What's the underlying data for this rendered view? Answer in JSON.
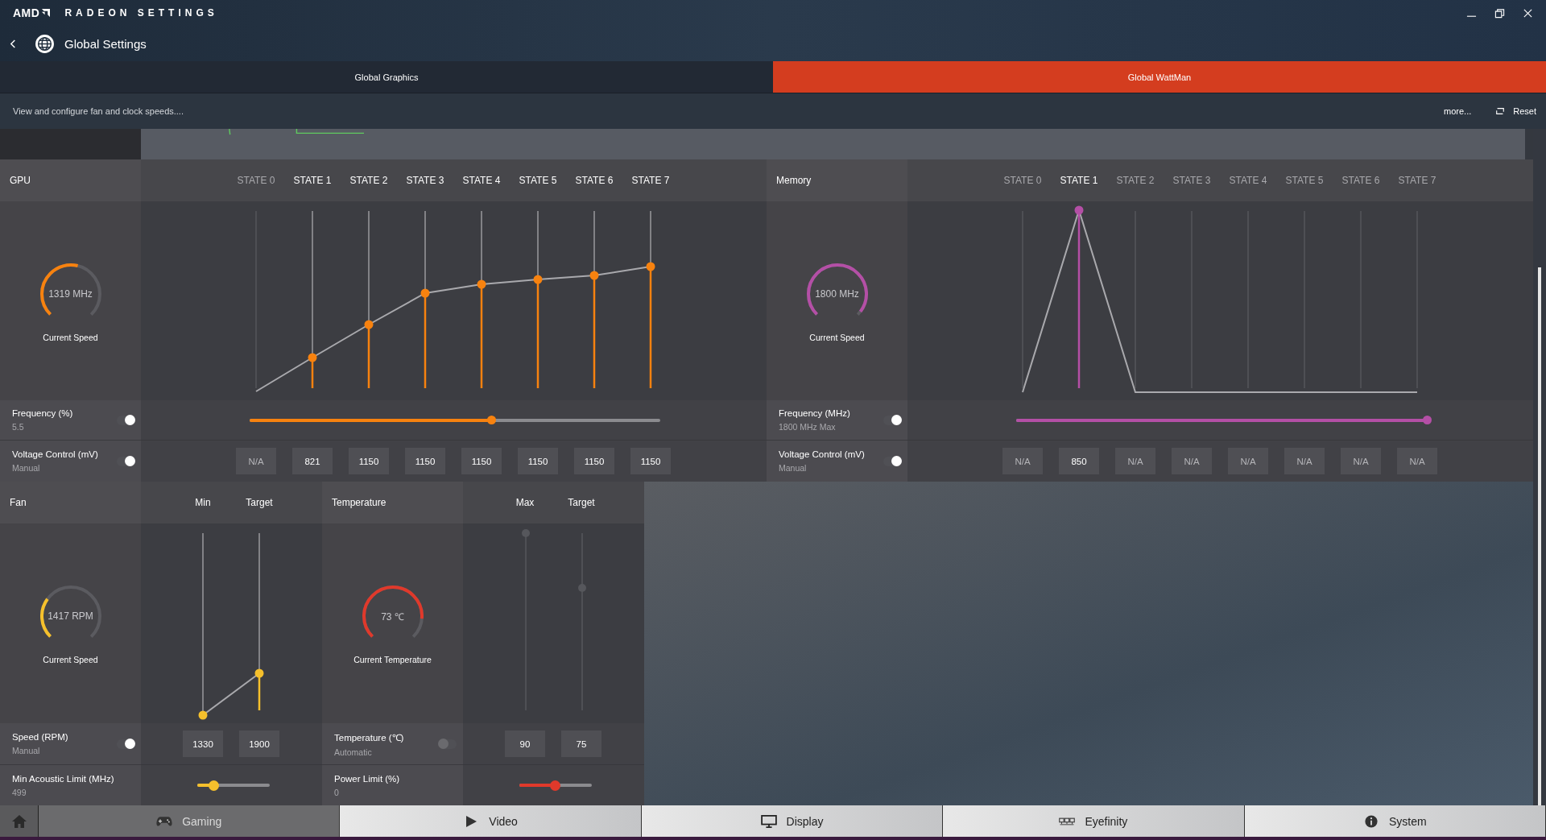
{
  "app": {
    "brand": "AMD",
    "title": "RADEON SETTINGS"
  },
  "header": {
    "title": "Global Settings"
  },
  "tabs": [
    {
      "label": "Global Graphics",
      "selected": false
    },
    {
      "label": "Global WattMan",
      "selected": true
    }
  ],
  "description": "View and configure fan and clock speeds....",
  "actions": {
    "more": "more...",
    "reset": "Reset"
  },
  "clock_panels": [
    {
      "title": "GPU",
      "color": "#f7820f",
      "gauge": {
        "reading": "1319 MHz",
        "caption": "Current Speed",
        "level": 0.55
      },
      "states": [
        {
          "label": "STATE 0",
          "disabled": true
        },
        {
          "label": "STATE 1",
          "disabled": false
        },
        {
          "label": "STATE 2",
          "disabled": false
        },
        {
          "label": "STATE 3",
          "disabled": false
        },
        {
          "label": "STATE 4",
          "disabled": false
        },
        {
          "label": "STATE 5",
          "disabled": false
        },
        {
          "label": "STATE 6",
          "disabled": false
        },
        {
          "label": "STATE 7",
          "disabled": false
        }
      ],
      "frequency": {
        "label": "Frequency (%)",
        "value": "5.5",
        "on": true,
        "level": 0.59
      },
      "voltage": {
        "label": "Voltage Control (mV)",
        "value": "Manual",
        "on": true,
        "cells": [
          {
            "text": "N/A",
            "disabled": true
          },
          {
            "text": "821",
            "disabled": false
          },
          {
            "text": "1150",
            "disabled": false
          },
          {
            "text": "1150",
            "disabled": false
          },
          {
            "text": "1150",
            "disabled": false
          },
          {
            "text": "1150",
            "disabled": false
          },
          {
            "text": "1150",
            "disabled": false
          },
          {
            "text": "1150",
            "disabled": false
          }
        ]
      }
    },
    {
      "title": "Memory",
      "color": "#b44fa6",
      "gauge": {
        "reading": "1800 MHz",
        "caption": "Current Speed",
        "level": 0.97
      },
      "states": [
        {
          "label": "STATE 0",
          "disabled": true
        },
        {
          "label": "STATE 1",
          "disabled": false
        },
        {
          "label": "STATE 2",
          "disabled": true
        },
        {
          "label": "STATE 3",
          "disabled": true
        },
        {
          "label": "STATE 4",
          "disabled": true
        },
        {
          "label": "STATE 5",
          "disabled": true
        },
        {
          "label": "STATE 6",
          "disabled": true
        },
        {
          "label": "STATE 7",
          "disabled": true
        }
      ],
      "frequency": {
        "label": "Frequency (MHz)",
        "value": "1800 MHz Max",
        "on": true,
        "level": 1.0
      },
      "voltage": {
        "label": "Voltage Control (mV)",
        "value": "Manual",
        "on": true,
        "cells": [
          {
            "text": "N/A",
            "disabled": true
          },
          {
            "text": "850",
            "disabled": false
          },
          {
            "text": "N/A",
            "disabled": true
          },
          {
            "text": "N/A",
            "disabled": true
          },
          {
            "text": "N/A",
            "disabled": true
          },
          {
            "text": "N/A",
            "disabled": true
          },
          {
            "text": "N/A",
            "disabled": true
          },
          {
            "text": "N/A",
            "disabled": true
          }
        ]
      }
    }
  ],
  "cooling_panels": [
    {
      "title": "Fan",
      "color": "#f5c02c",
      "gauge": {
        "reading": "1417 RPM",
        "caption": "Current Speed",
        "level": 0.3
      },
      "columns": [
        "Min",
        "Target"
      ],
      "control": {
        "label": "Speed (RPM)",
        "value": "Manual",
        "on": true
      },
      "fields": [
        "1330",
        "1900"
      ],
      "limit": {
        "label": "Min Acoustic Limit (MHz)",
        "value": "499",
        "level": 0.23
      }
    },
    {
      "title": "Temperature",
      "color": "#e0392b",
      "gauge": {
        "reading": "73 ℃",
        "caption": "Current Temperature",
        "level": 0.85
      },
      "columns": [
        "Max",
        "Target"
      ],
      "control": {
        "label": "Temperature (℃)",
        "value": "Automatic",
        "on": false
      },
      "fields": [
        "90",
        "75"
      ],
      "limit": {
        "label": "Power Limit (%)",
        "value": "0",
        "level": 0.49
      }
    }
  ],
  "nav": [
    {
      "label": "Gaming",
      "kind": "gaming",
      "highlighted": true
    },
    {
      "label": "Video",
      "kind": "video",
      "highlighted": false
    },
    {
      "label": "Display",
      "kind": "display",
      "highlighted": false
    },
    {
      "label": "Eyefinity",
      "kind": "eyefinity",
      "highlighted": false
    },
    {
      "label": "System",
      "kind": "system",
      "highlighted": false
    }
  ]
}
